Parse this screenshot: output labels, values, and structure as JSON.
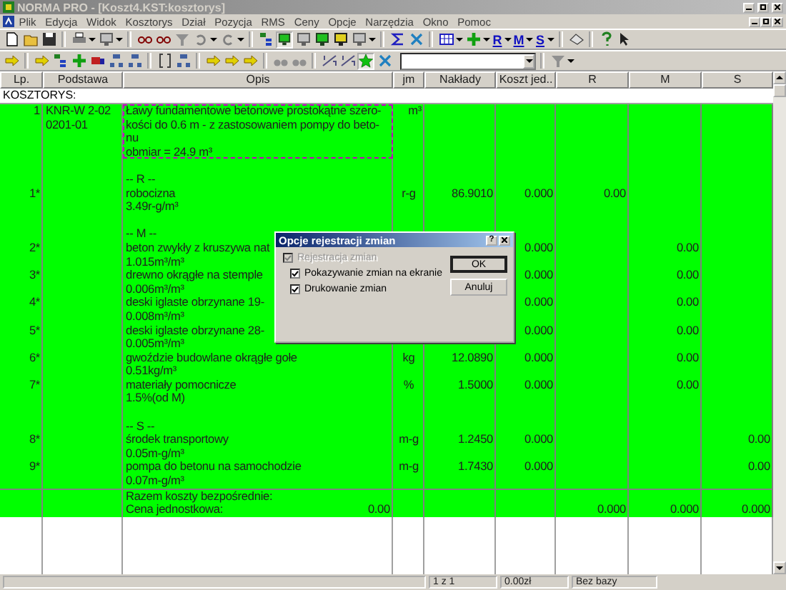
{
  "window": {
    "title": "NORMA PRO - [Koszt4.KST:kosztorys]",
    "active": false
  },
  "menu": [
    "Plik",
    "Edycja",
    "Widok",
    "Kosztorys",
    "Dział",
    "Pozycja",
    "RMS",
    "Ceny",
    "Opcje",
    "Narzędzia",
    "Okno",
    "Pomoc"
  ],
  "toolbar": {
    "letter_buttons": [
      "R",
      "M",
      "S"
    ],
    "pressed_view": true,
    "pressed_star": true
  },
  "table": {
    "columns": [
      "Lp.",
      "Podstawa",
      "Opis",
      "jm",
      "Nakłady",
      "Koszt jed..",
      "R",
      "M",
      "S"
    ],
    "section_title": "KOSZTORYS:",
    "rows": [
      {
        "kind": "position",
        "lp": "1",
        "podstawa": [
          "KNR-W 2-02",
          "0201-01"
        ],
        "opis": [
          "Ławy fundamentowe betonowe prostokątne szero-",
          "kości do 0.6 m - z zastosowaniem pompy do beto-",
          "nu",
          "obmiar  = 24.9 m³"
        ],
        "jm": "m³",
        "selected": true
      },
      {
        "kind": "section",
        "label": "-- R --"
      },
      {
        "kind": "item",
        "lp": "1*",
        "name": "robocizna",
        "norm": "3.49r-g/m³",
        "jm": "r-g",
        "naklady": "86.9010",
        "koszt": "0.000",
        "r": "0.00"
      },
      {
        "kind": "section",
        "label": "-- M --"
      },
      {
        "kind": "item",
        "lp": "2*",
        "name": "beton zwykły z kruszywa nat",
        "norm": "1.015m³/m³",
        "koszt": "0.000",
        "m": "0.00"
      },
      {
        "kind": "item",
        "lp": "3*",
        "name": "drewno okrągłe na stemple",
        "norm": "0.006m³/m³",
        "koszt": "0.000",
        "m": "0.00"
      },
      {
        "kind": "item",
        "lp": "4*",
        "name": "deski iglaste obrzynane 19-",
        "norm": "0.008m³/m³",
        "koszt": "0.000",
        "m": "0.00"
      },
      {
        "kind": "item",
        "lp": "5*",
        "name": "deski iglaste obrzynane 28-",
        "norm": "0.005m³/m³",
        "koszt": "0.000",
        "m": "0.00"
      },
      {
        "kind": "item",
        "lp": "6*",
        "name": "gwoździe budowlane okrągłe gołe",
        "norm": "0.51kg/m³",
        "jm": "kg",
        "naklady": "12.0890",
        "koszt": "0.000",
        "m": "0.00"
      },
      {
        "kind": "item",
        "lp": "7*",
        "name": "materiały pomocnicze",
        "norm": "1.5%(od M)",
        "jm": "%",
        "naklady": "1.5000",
        "koszt": "0.000",
        "m": "0.00"
      },
      {
        "kind": "section",
        "label": "-- S --"
      },
      {
        "kind": "item",
        "lp": "8*",
        "name": "środek transportowy",
        "norm": "0.05m-g/m³",
        "jm": "m-g",
        "naklady": "1.2450",
        "koszt": "0.000",
        "s": "0.00"
      },
      {
        "kind": "item",
        "lp": "9*",
        "name": "pompa do betonu na samochodzie",
        "norm": "0.07m-g/m³",
        "jm": "m-g",
        "naklady": "1.7430",
        "koszt": "0.000",
        "s": "0.00"
      },
      {
        "kind": "summary",
        "lines": [
          "Razem koszty bezpośrednie:",
          "Cena jednostkowa:"
        ],
        "opis_value": "0.00",
        "r": "0.000",
        "m": "0.000",
        "s": "0.000"
      }
    ]
  },
  "dialog": {
    "title": "Opcje rejestracji zmian",
    "help_button": "?",
    "options": [
      {
        "label": "Rejestracja zmian",
        "checked": true,
        "disabled": true
      },
      {
        "label": "Pokazywanie zmian na ekranie",
        "checked": true,
        "disabled": false
      },
      {
        "label": "Drukowanie zmian",
        "checked": true,
        "disabled": false
      }
    ],
    "buttons": [
      {
        "label": "OK",
        "default": true
      },
      {
        "label": "Anuluj",
        "default": false
      }
    ]
  },
  "status_bar": [
    "1 z 1",
    "0.00zł",
    "Bez bazy"
  ]
}
